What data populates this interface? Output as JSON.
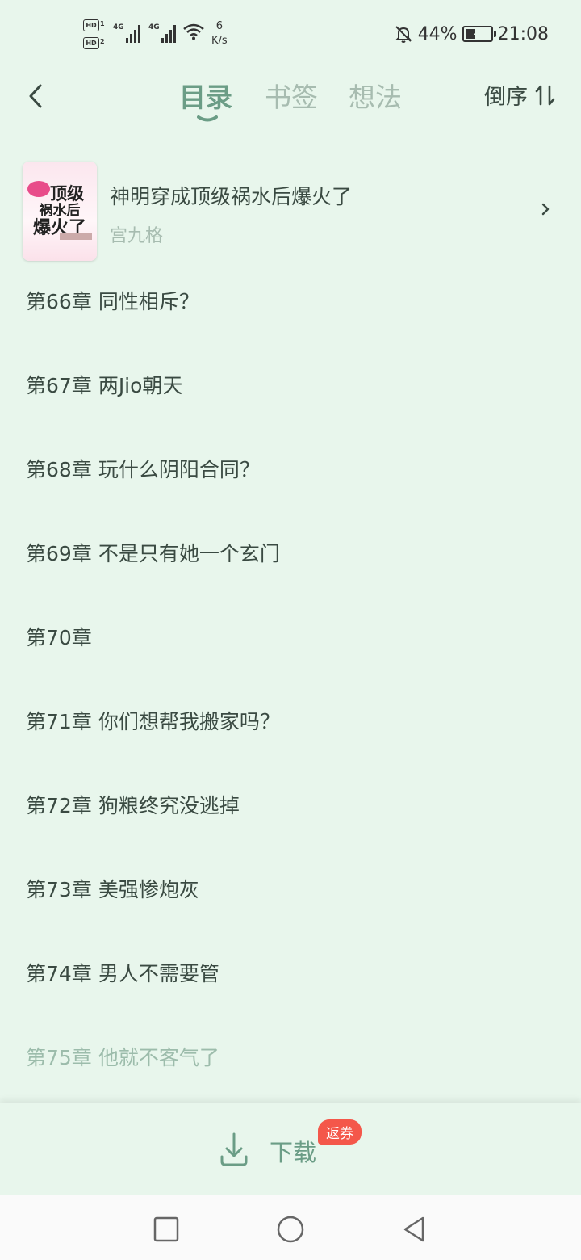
{
  "status": {
    "hd1": "HD",
    "hd1_sub": "1",
    "hd2": "HD",
    "hd2_sub": "2",
    "net1": "4G",
    "net2": "4G",
    "speed_value": "6",
    "speed_unit": "K/s",
    "battery": "44%",
    "battery_level": 0.44,
    "time": "21:08"
  },
  "header": {
    "tabs": [
      {
        "label": "目录",
        "active": true
      },
      {
        "label": "书签",
        "active": false
      },
      {
        "label": "想法",
        "active": false
      }
    ],
    "sort_label": "倒序"
  },
  "book": {
    "title": "神明穿成顶级祸水后爆火了",
    "author": "宫九格",
    "cover_text": [
      "顶级",
      "祸水后",
      "爆火了"
    ]
  },
  "chapters": [
    {
      "num": "第66章",
      "title": "同性相斥？"
    },
    {
      "num": "第67章",
      "title": "两Jio朝天"
    },
    {
      "num": "第68章",
      "title": "玩什么阴阳合同？"
    },
    {
      "num": "第69章",
      "title": "不是只有她一个玄门"
    },
    {
      "num": "第70章",
      "title": ""
    },
    {
      "num": "第71章",
      "title": "你们想帮我搬家吗？"
    },
    {
      "num": "第72章",
      "title": "狗粮终究没逃掉"
    },
    {
      "num": "第73章",
      "title": "美强惨炮灰"
    },
    {
      "num": "第74章",
      "title": "男人不需要管"
    },
    {
      "num": "第75章",
      "title": "他就不客气了"
    }
  ],
  "bottom": {
    "download_label": "下载",
    "badge": "返券"
  },
  "colors": {
    "background": "#e8f6ec",
    "accent": "#6b9d86",
    "badge": "#f4574a"
  }
}
